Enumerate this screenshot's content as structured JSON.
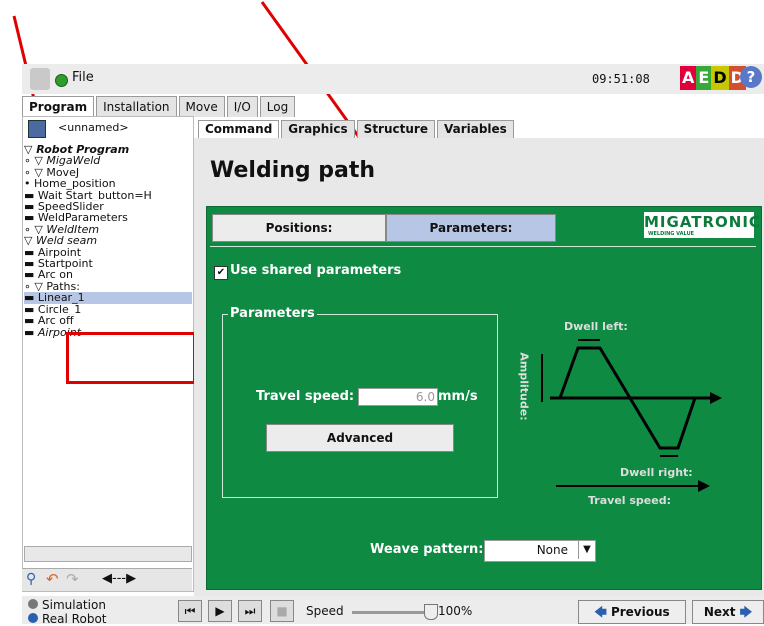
{
  "header": {
    "file_label": "File",
    "clock": "09:51:08",
    "aedd": [
      "A",
      "E",
      "D",
      "D"
    ],
    "aedd_colors": [
      "#e0003c",
      "#38a838",
      "#c8c800",
      "#d05030"
    ],
    "help_label": "?"
  },
  "top_tabs": [
    {
      "label": "Program",
      "active": true
    },
    {
      "label": "Installation",
      "active": false
    },
    {
      "label": "Move",
      "active": false
    },
    {
      "label": "I/O",
      "active": false
    },
    {
      "label": "Log",
      "active": false
    }
  ],
  "left": {
    "program_name": "<unnamed>",
    "tree": [
      "▽ Robot Program",
      "∘ ▽ MigaWeld",
      "  ∘ ▽ MoveJ",
      "      • Home_position",
      "  ▬ Wait Start_button=H",
      "  ▬ SpeedSlider",
      "  ▬ WeldParameters",
      "  ∘ ▽ WeldItem",
      "      ▽ Weld seam",
      "        ▬ Airpoint",
      "        ▬ Startpoint",
      "        ▬ Arc on",
      "      ∘ ▽ Paths:",
      "          ▬ Linear_1",
      "          ▬ Circle_1",
      "        ▬ Arc off",
      "        ▬ Airpoint"
    ]
  },
  "sub_tabs": [
    {
      "label": "Command",
      "active": true
    },
    {
      "label": "Graphics",
      "active": false
    },
    {
      "label": "Structure",
      "active": false
    },
    {
      "label": "Variables",
      "active": false
    }
  ],
  "main": {
    "title": "Welding path",
    "positions_btn": "Positions:",
    "parameters_btn": "Parameters:",
    "brand": "MIGATRONIC",
    "brand_sub": "WELDING VALUE",
    "use_shared": "Use shared parameters",
    "group_title": "Parameters",
    "travel_speed_label": "Travel speed:",
    "travel_speed_value": "6.0",
    "travel_speed_unit": "mm/s",
    "advanced_btn": "Advanced",
    "dwell_left": "Dwell left:",
    "dwell_right": "Dwell right:",
    "amplitude": "Amplitude:",
    "travel_speed_diagram": "Travel speed:",
    "weave_label": "Weave pattern:",
    "weave_value": "None"
  },
  "footer": {
    "simulation": "Simulation",
    "real_robot": "Real Robot",
    "speed_label": "Speed",
    "speed_value": "100%",
    "speed_fraction": 1.0,
    "previous": "Previous",
    "next": "Next"
  },
  "colors": {
    "panel_green": "#0f8a43",
    "annotation_red": "#e00000",
    "selected_tab": "#b7c6e4"
  }
}
